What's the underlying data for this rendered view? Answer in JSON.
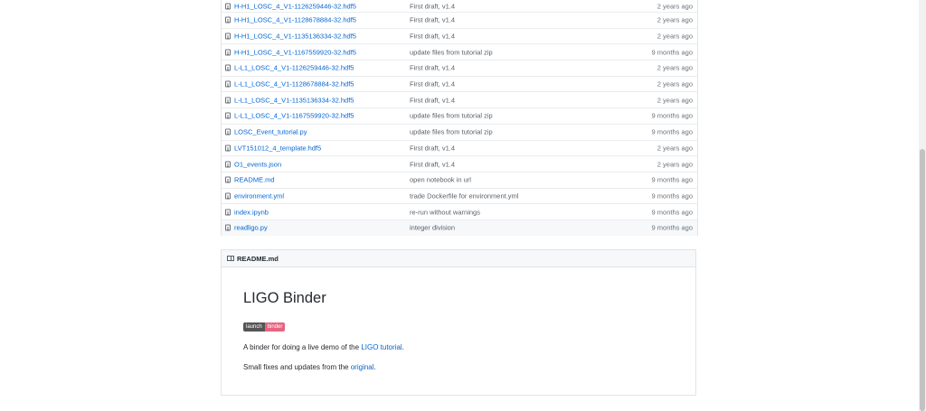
{
  "files": [
    {
      "name": "H-H1_LOSC_4_V1-1126259446-32.hdf5",
      "message": "First draft, v1.4",
      "age": "2 years ago"
    },
    {
      "name": "H-H1_LOSC_4_V1-1128678884-32.hdf5",
      "message": "First draft, v1.4",
      "age": "2 years ago"
    },
    {
      "name": "H-H1_LOSC_4_V1-1135136334-32.hdf5",
      "message": "First draft, v1.4",
      "age": "2 years ago"
    },
    {
      "name": "H-H1_LOSC_4_V1-1167559920-32.hdf5",
      "message": "update files from tutorial zip",
      "age": "9 months ago"
    },
    {
      "name": "L-L1_LOSC_4_V1-1126259446-32.hdf5",
      "message": "First draft, v1.4",
      "age": "2 years ago"
    },
    {
      "name": "L-L1_LOSC_4_V1-1128678884-32.hdf5",
      "message": "First draft, v1.4",
      "age": "2 years ago"
    },
    {
      "name": "L-L1_LOSC_4_V1-1135136334-32.hdf5",
      "message": "First draft, v1.4",
      "age": "2 years ago"
    },
    {
      "name": "L-L1_LOSC_4_V1-1167559920-32.hdf5",
      "message": "update files from tutorial zip",
      "age": "9 months ago"
    },
    {
      "name": "LOSC_Event_tutorial.py",
      "message": "update files from tutorial zip",
      "age": "9 months ago"
    },
    {
      "name": "LVT151012_4_template.hdf5",
      "message": "First draft, v1.4",
      "age": "2 years ago"
    },
    {
      "name": "O1_events.json",
      "message": "First draft, v1.4",
      "age": "2 years ago"
    },
    {
      "name": "README.md",
      "message": "open notebook in url",
      "age": "9 months ago"
    },
    {
      "name": "environment.yml",
      "message": "trade Dockerfile for environment.yml",
      "age": "9 months ago"
    },
    {
      "name": "index.ipynb",
      "message": "re-run without warnings",
      "age": "9 months ago"
    },
    {
      "name": "readligo.py",
      "message": "integer division",
      "age": "9 months ago"
    }
  ],
  "readme": {
    "header": "README.md",
    "title": "LIGO Binder",
    "badge_left": "launch",
    "badge_right": "binder",
    "p1_before": "A binder for doing a live demo of the ",
    "p1_link": "LIGO tutorial",
    "p1_after": ".",
    "p2_before": "Small fixes and updates from the ",
    "p2_link": "original",
    "p2_after": "."
  }
}
